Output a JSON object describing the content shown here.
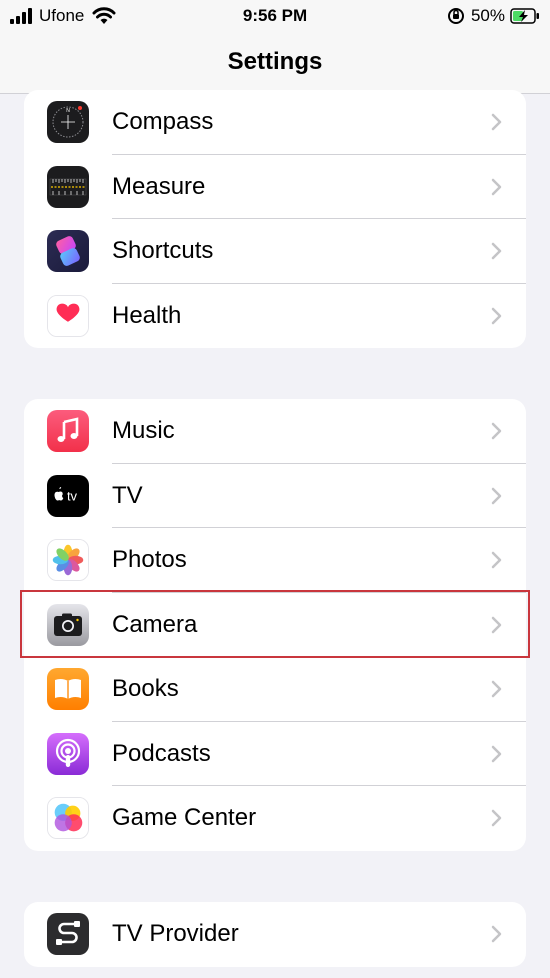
{
  "status": {
    "carrier": "Ufone",
    "time": "9:56 PM",
    "battery": "50%"
  },
  "nav": {
    "title": "Settings"
  },
  "groups": [
    {
      "items": [
        {
          "label": "Compass",
          "icon": "compass-icon"
        },
        {
          "label": "Measure",
          "icon": "measure-icon"
        },
        {
          "label": "Shortcuts",
          "icon": "shortcuts-icon"
        },
        {
          "label": "Health",
          "icon": "health-icon"
        }
      ]
    },
    {
      "items": [
        {
          "label": "Music",
          "icon": "music-icon"
        },
        {
          "label": "TV",
          "icon": "appletv-icon"
        },
        {
          "label": "Photos",
          "icon": "photos-icon"
        },
        {
          "label": "Camera",
          "icon": "camera-icon",
          "highlighted": true
        },
        {
          "label": "Books",
          "icon": "books-icon"
        },
        {
          "label": "Podcasts",
          "icon": "podcasts-icon"
        },
        {
          "label": "Game Center",
          "icon": "game-center-icon"
        }
      ]
    },
    {
      "items": [
        {
          "label": "TV Provider",
          "icon": "tv-provider-icon"
        }
      ]
    }
  ],
  "colors": {
    "highlight": "#c9363d",
    "background": "#f2f2f7"
  }
}
